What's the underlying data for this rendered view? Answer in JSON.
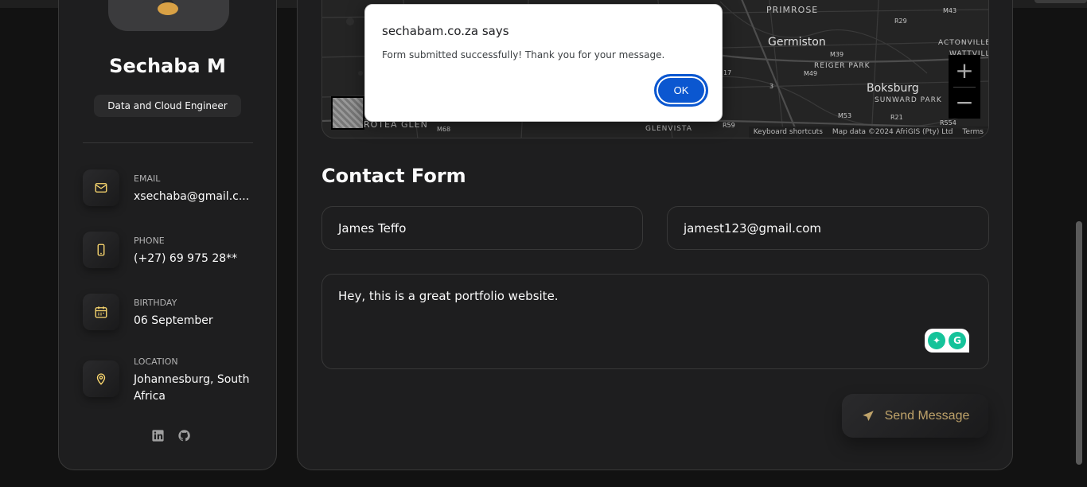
{
  "profile": {
    "name": "Sechaba M",
    "role": "Data and Cloud Engineer"
  },
  "contacts": [
    {
      "label": "Email",
      "value": "xsechaba@gmail.c...",
      "icon": "mail-icon"
    },
    {
      "label": "Phone",
      "value": "(+27) 69 975 28**",
      "icon": "phone-icon"
    },
    {
      "label": "Birthday",
      "value": "06 September",
      "icon": "calendar-icon"
    },
    {
      "label": "Location",
      "value": "Johannesburg, South Africa",
      "icon": "location-pin-icon"
    }
  ],
  "socials": [
    "linkedin-icon",
    "github-icon"
  ],
  "map": {
    "labels": [
      "PRIMROSE",
      "Germiston",
      "REIGER PARK",
      "Boksburg",
      "SUNWARD PARK",
      "ACTONVILLE",
      "WATTVILLE",
      "ROTEA GLEN",
      "GLENVISTA"
    ],
    "road_labels": [
      "R29",
      "M43",
      "M39",
      "M49",
      "3",
      "17",
      "M68",
      "M53",
      "R21",
      "R554",
      "R59"
    ],
    "zoom_in": "+",
    "zoom_out": "−",
    "footer": {
      "shortcuts": "Keyboard shortcuts",
      "attribution": "Map data ©2024 AfriGIS (Pty) Ltd",
      "terms": "Terms"
    }
  },
  "form": {
    "title": "Contact Form",
    "fullname_value": "James Teffo",
    "email_value": "jamest123@gmail.com",
    "message_value": "Hey, this is a great portfolio website.",
    "send_label": "Send Message"
  },
  "dialog": {
    "title": "sechabam.co.za says",
    "message": "Form submitted successfully! Thank you for your message.",
    "ok_label": "OK"
  },
  "colors": {
    "accent": "#ffdb70",
    "button_text": "#bfa36a",
    "dialog_button": "#0b57d0",
    "background": "#121212",
    "card": "#1e1e1f"
  }
}
